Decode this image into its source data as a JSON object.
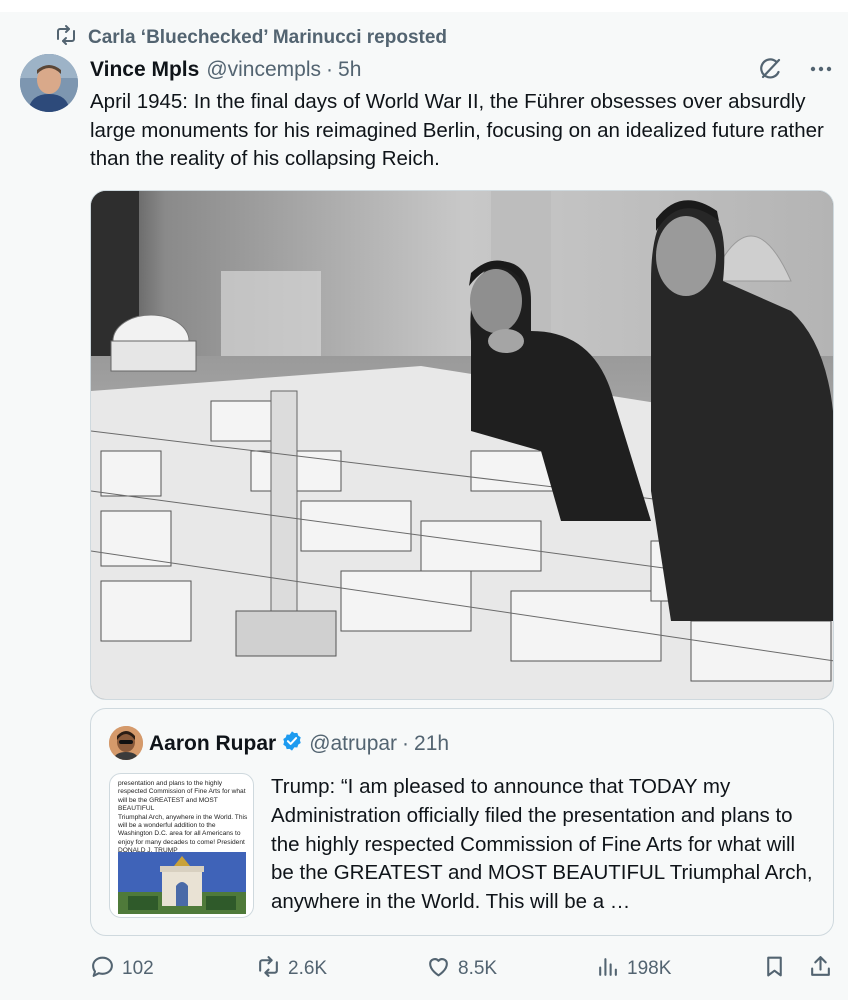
{
  "repost": {
    "icon": "repost-icon",
    "text": "Carla ‘Bluechecked’ Marinucci reposted"
  },
  "tweet": {
    "author_name": "Vince Mpls",
    "author_handle": "@vincempls",
    "separator": "·",
    "time": "5h",
    "text": "April 1945: In the final days of World War II, the Führer obsesses over absurdly large monuments for his reimagined Berlin, focusing on an idealized future rather than the reality of his collapsing Reich.",
    "header_icons": [
      "grok-icon",
      "more-icon"
    ],
    "photo_icon": "architectural-model-photo"
  },
  "quote": {
    "author_name": "Aaron Rupar",
    "verified_icon": "verified-badge-icon",
    "author_handle": "@atrupar",
    "separator": "·",
    "time": "21h",
    "text": "Trump: “I am pleased to announce that TODAY my Administration officially filed the presentation and plans to the highly respected Commission of Fine Arts for what will be the GREATEST and MOST BEAUTIFUL Triumphal Arch, anywhere in the World. This will be a …",
    "thumbnail_lines": [
      "presentation and plans to the highly",
      "respected Commission of Fine Arts for what",
      "will be the GREATEST and MOST BEAUTIFUL",
      "Triumphal Arch, anywhere in the World. This",
      "will be a wonderful addition to the",
      "Washington D.C. area for all Americans to",
      "enjoy for many decades to come! President",
      "DONALD J. TRUMP"
    ]
  },
  "actions": {
    "replies": "102",
    "reposts": "2.6K",
    "likes": "8.5K",
    "views": "198K",
    "icons": [
      "reply-icon",
      "repost-icon",
      "like-icon",
      "views-icon",
      "bookmark-icon",
      "share-icon"
    ]
  },
  "colors": {
    "text": "#0f1419",
    "secondary": "#536471",
    "verified": "#1d9bf0",
    "border": "#cfd9de",
    "background": "#f7f9f9"
  }
}
